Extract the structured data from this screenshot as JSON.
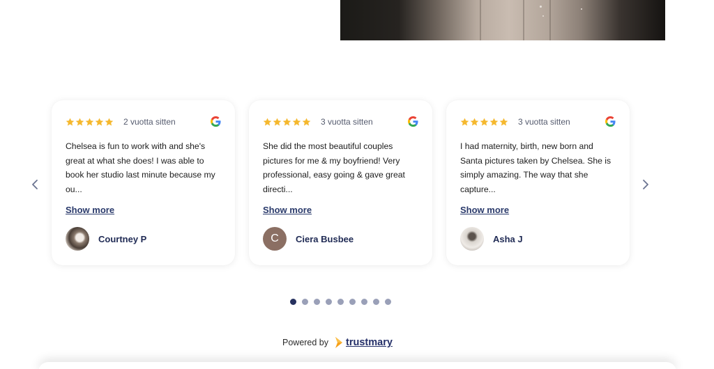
{
  "reviews": [
    {
      "rating": 5,
      "time": "2 vuotta sitten",
      "source_icon": "google-icon",
      "text": "Chelsea is fun to work with and she's great at what she does! I was able to book her studio last minute because my ou...",
      "show_more": "Show more",
      "author": "Courtney P",
      "avatar": "photo"
    },
    {
      "rating": 5,
      "time": "3 vuotta sitten",
      "source_icon": "google-icon",
      "text": "She did the most beautiful couples pictures for me & my boyfriend! Very professional, easy going & gave great directi...",
      "show_more": "Show more",
      "author": "Ciera Busbee",
      "avatar": "C"
    },
    {
      "rating": 5,
      "time": "3 vuotta sitten",
      "source_icon": "google-icon",
      "text": "I had maternity, birth, new born and Santa pictures taken by Chelsea. She is simply amazing. The way that she capture...",
      "show_more": "Show more",
      "author": "Asha J",
      "avatar": "photo"
    }
  ],
  "pagination": {
    "total": 9,
    "active": 1
  },
  "footer": {
    "powered_by": "Powered by",
    "brand": "trustmary"
  },
  "colors": {
    "star": "#f5b82e",
    "name": "#1f2a54",
    "link": "#2a3a6b",
    "dot": "#9aa0b8",
    "dot_active": "#26315f",
    "avatar_letter_bg": "#8b6f63",
    "brand_orange": "#f7a11a"
  },
  "icons": {
    "prev": "chevron-left-icon",
    "next": "chevron-right-icon",
    "star": "star-icon",
    "brand": "trustmary-logo"
  }
}
